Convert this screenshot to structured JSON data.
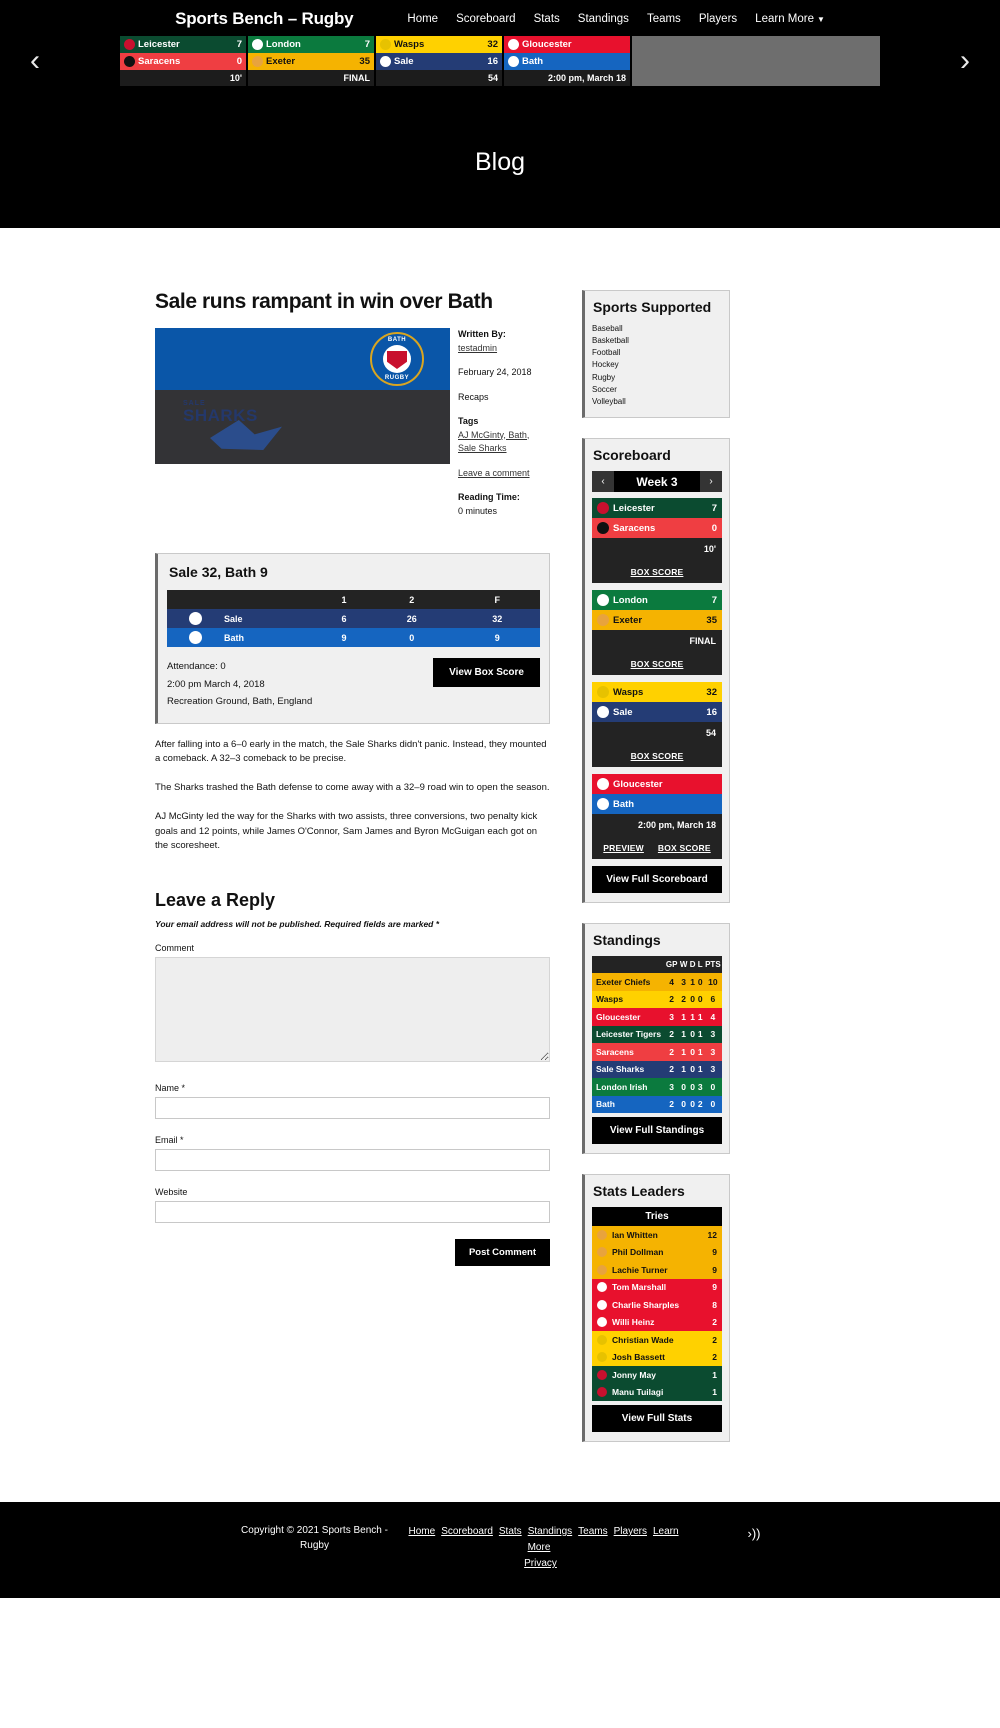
{
  "header": {
    "brand": "Sports Bench – Rugby",
    "nav": [
      "Home",
      "Scoreboard",
      "Stats",
      "Standings",
      "Teams",
      "Players"
    ],
    "nav_more": "Learn More",
    "prev_arrow": "‹",
    "next_arrow": "›"
  },
  "ticker": {
    "games": [
      {
        "away": {
          "name": "Leicester",
          "score": "7",
          "color": "#0b4b30",
          "text": "#ffffff",
          "logo": "#c8102e"
        },
        "home": {
          "name": "Saracens",
          "score": "0",
          "color": "#ef3e42",
          "text": "#ffffff",
          "logo": "#111111"
        },
        "status": "10'"
      },
      {
        "away": {
          "name": "London",
          "score": "7",
          "color": "#0b7a3e",
          "text": "#ffffff",
          "logo": "#ffffff"
        },
        "home": {
          "name": "Exeter",
          "score": "35",
          "color": "#f5b301",
          "text": "#111111",
          "logo": "#e8a33d"
        },
        "status": "FINAL"
      },
      {
        "away": {
          "name": "Wasps",
          "score": "32",
          "color": "#ffd100",
          "text": "#111111",
          "logo": "#e7c200"
        },
        "home": {
          "name": "Sale",
          "score": "16",
          "color": "#243c75",
          "text": "#ffffff",
          "logo": "#ffffff"
        },
        "status": "54"
      },
      {
        "away": {
          "name": "Gloucester",
          "score": "",
          "color": "#e8112d",
          "text": "#ffffff",
          "logo": "#ffffff"
        },
        "home": {
          "name": "Bath",
          "score": "",
          "color": "#1565c0",
          "text": "#ffffff",
          "logo": "#ffffff"
        },
        "status": "2:00 pm, March 18"
      }
    ]
  },
  "hero": {
    "title": "Blog"
  },
  "post": {
    "title": "Sale runs rampant in win over Bath",
    "featured_top_text": {
      "line1": "BATH",
      "line2": "RUGBY"
    },
    "featured_bottom_text": {
      "line1": "SALE",
      "line2": "SHARKS"
    },
    "meta": {
      "written_by_label": "Written By:",
      "author": "testadmin",
      "date": "February 24, 2018",
      "category": "Recaps",
      "tags_label": "Tags",
      "tags": [
        "AJ McGinty",
        "Bath",
        "Sale Sharks"
      ],
      "tags_line1": "AJ McGinty, Bath,",
      "tags_line2": "Sale Sharks",
      "comment_link": "Leave a comment",
      "reading_label": "Reading Time:",
      "reading_value": "0 minutes"
    },
    "boxscore": {
      "title": "Sale 32, Bath 9",
      "columns": [
        "",
        "",
        "1",
        "2",
        "F"
      ],
      "rows": [
        {
          "team": "Sale",
          "logo_color": "#ffffff",
          "row_color": "#243c75",
          "p1": "6",
          "p2": "26",
          "f": "32"
        },
        {
          "team": "Bath",
          "logo_color": "#ffffff",
          "row_color": "#1565c0",
          "p1": "9",
          "p2": "0",
          "f": "9"
        }
      ],
      "attendance": "Attendance: 0",
      "datetime": "2:00 pm March 4, 2018",
      "venue": "Recreation Ground, Bath, England",
      "button": "View Box Score"
    },
    "paragraphs": [
      "After falling into a 6–0 early in the match, the Sale Sharks didn't panic. Instead, they mounted a comeback. A 32–3 comeback to be precise.",
      "The Sharks trashed the Bath defense to come away with a 32–9 road win to open the season.",
      "AJ McGinty led the way for the Sharks with two assists, three conversions, two penalty kick goals and 12 points, while James O'Connor, Sam James and Byron McGuigan each got on the scoresheet."
    ]
  },
  "reply": {
    "heading": "Leave a Reply",
    "note": "Your email address will not be published. Required fields are marked *",
    "comment_label": "Comment",
    "name_label": "Name *",
    "email_label": "Email *",
    "website_label": "Website",
    "submit": "Post Comment"
  },
  "sidebar": {
    "sports": {
      "title": "Sports Supported",
      "items": [
        "Baseball",
        "Basketball",
        "Football",
        "Hockey",
        "Rugby",
        "Soccer",
        "Volleyball"
      ]
    },
    "scoreboard": {
      "title": "Scoreboard",
      "week": "Week 3",
      "prev": "‹",
      "next": "›",
      "games": [
        {
          "away": {
            "name": "Leicester",
            "score": "7",
            "color": "#0b4b30",
            "text": "#ffffff",
            "logo": "#c8102e"
          },
          "home": {
            "name": "Saracens",
            "score": "0",
            "color": "#ef3e42",
            "text": "#ffffff",
            "logo": "#111111"
          },
          "status": "10'",
          "links": [
            {
              "label": "BOX SCORE"
            }
          ]
        },
        {
          "away": {
            "name": "London",
            "score": "7",
            "color": "#0b7a3e",
            "text": "#ffffff",
            "logo": "#ffffff"
          },
          "home": {
            "name": "Exeter",
            "score": "35",
            "color": "#f5b301",
            "text": "#111111",
            "logo": "#e8a33d"
          },
          "status": "FINAL",
          "links": [
            {
              "label": "BOX SCORE"
            }
          ]
        },
        {
          "away": {
            "name": "Wasps",
            "score": "32",
            "color": "#ffd100",
            "text": "#111111",
            "logo": "#e7c200"
          },
          "home": {
            "name": "Sale",
            "score": "16",
            "color": "#243c75",
            "text": "#ffffff",
            "logo": "#ffffff"
          },
          "status": "54",
          "links": [
            {
              "label": "BOX SCORE"
            }
          ]
        },
        {
          "away": {
            "name": "Gloucester",
            "score": "",
            "color": "#e8112d",
            "text": "#ffffff",
            "logo": "#ffffff"
          },
          "home": {
            "name": "Bath",
            "score": "",
            "color": "#1565c0",
            "text": "#ffffff",
            "logo": "#ffffff"
          },
          "status": "2:00 pm, March 18",
          "links": [
            {
              "label": "PREVIEW"
            },
            {
              "label": "BOX SCORE"
            }
          ]
        }
      ],
      "button": "View Full Scoreboard"
    },
    "standings": {
      "title": "Standings",
      "columns": [
        "GP",
        "W",
        "D",
        "L",
        "PTS"
      ],
      "rows": [
        {
          "team": "Exeter Chiefs",
          "gp": "4",
          "w": "3",
          "d": "1",
          "l": "0",
          "pts": "10",
          "color": "#f5b301",
          "text": "#111111"
        },
        {
          "team": "Wasps",
          "gp": "2",
          "w": "2",
          "d": "0",
          "l": "0",
          "pts": "6",
          "color": "#ffd100",
          "text": "#111111"
        },
        {
          "team": "Gloucester",
          "gp": "3",
          "w": "1",
          "d": "1",
          "l": "1",
          "pts": "4",
          "color": "#e8112d",
          "text": "#ffffff"
        },
        {
          "team": "Leicester Tigers",
          "gp": "2",
          "w": "1",
          "d": "0",
          "l": "1",
          "pts": "3",
          "color": "#0b4b30",
          "text": "#ffffff"
        },
        {
          "team": "Saracens",
          "gp": "2",
          "w": "1",
          "d": "0",
          "l": "1",
          "pts": "3",
          "color": "#ef3e42",
          "text": "#ffffff"
        },
        {
          "team": "Sale Sharks",
          "gp": "2",
          "w": "1",
          "d": "0",
          "l": "1",
          "pts": "3",
          "color": "#243c75",
          "text": "#ffffff"
        },
        {
          "team": "London Irish",
          "gp": "3",
          "w": "0",
          "d": "0",
          "l": "3",
          "pts": "0",
          "color": "#0b7a3e",
          "text": "#ffffff"
        },
        {
          "team": "Bath",
          "gp": "2",
          "w": "0",
          "d": "0",
          "l": "2",
          "pts": "0",
          "color": "#1565c0",
          "text": "#ffffff"
        }
      ],
      "button": "View Full Standings"
    },
    "stats": {
      "title": "Stats Leaders",
      "section": "Tries",
      "rows": [
        {
          "player": "Ian Whitten",
          "value": "12",
          "color": "#f5b301",
          "text": "#111111",
          "logo": "#e8a33d"
        },
        {
          "player": "Phil Dollman",
          "value": "9",
          "color": "#f5b301",
          "text": "#111111",
          "logo": "#e8a33d"
        },
        {
          "player": "Lachie Turner",
          "value": "9",
          "color": "#f5b301",
          "text": "#111111",
          "logo": "#e8a33d"
        },
        {
          "player": "Tom Marshall",
          "value": "9",
          "color": "#e8112d",
          "text": "#ffffff",
          "logo": "#ffffff"
        },
        {
          "player": "Charlie Sharples",
          "value": "8",
          "color": "#e8112d",
          "text": "#ffffff",
          "logo": "#ffffff"
        },
        {
          "player": "Willi Heinz",
          "value": "2",
          "color": "#e8112d",
          "text": "#ffffff",
          "logo": "#ffffff"
        },
        {
          "player": "Christian Wade",
          "value": "2",
          "color": "#ffd100",
          "text": "#111111",
          "logo": "#e7c200"
        },
        {
          "player": "Josh Bassett",
          "value": "2",
          "color": "#ffd100",
          "text": "#111111",
          "logo": "#e7c200"
        },
        {
          "player": "Jonny May",
          "value": "1",
          "color": "#0b4b30",
          "text": "#ffffff",
          "logo": "#c8102e"
        },
        {
          "player": "Manu Tuilagi",
          "value": "1",
          "color": "#0b4b30",
          "text": "#ffffff",
          "logo": "#c8102e"
        }
      ],
      "button": "View Full Stats"
    }
  },
  "footer": {
    "copyright": "Copyright © 2021 Sports Bench - Rugby",
    "links": [
      "Home",
      "Scoreboard",
      "Stats",
      "Standings",
      "Teams",
      "Players",
      "Learn More",
      "Privacy"
    ],
    "rss_icon": "rss-icon"
  }
}
